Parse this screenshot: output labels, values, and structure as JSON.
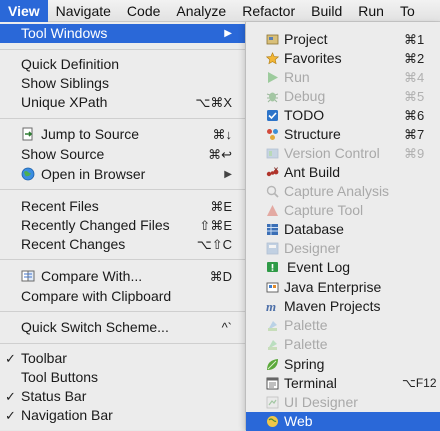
{
  "menubar": {
    "items": [
      {
        "label": "View",
        "active": true
      },
      {
        "label": "Navigate"
      },
      {
        "label": "Code"
      },
      {
        "label": "Analyze"
      },
      {
        "label": "Refactor"
      },
      {
        "label": "Build"
      },
      {
        "label": "Run"
      },
      {
        "label": "To"
      }
    ]
  },
  "view_menu": {
    "tool_windows": {
      "label": "Tool Windows",
      "arrow": "▶"
    },
    "quick_definition": {
      "label": "Quick Definition"
    },
    "show_siblings": {
      "label": "Show Siblings"
    },
    "unique_xpath": {
      "label": "Unique XPath",
      "shortcut": "⌥⌘X"
    },
    "jump_to_source": {
      "label": "Jump to Source",
      "shortcut": "⌘↓",
      "icon": "jump-to-source-icon"
    },
    "show_source": {
      "label": "Show Source",
      "shortcut": "⌘↩"
    },
    "open_in_browser": {
      "label": "Open in Browser",
      "arrow": "▶",
      "icon": "globe-icon"
    },
    "recent_files": {
      "label": "Recent Files",
      "shortcut": "⌘E"
    },
    "recently_changed_files": {
      "label": "Recently Changed Files",
      "shortcut": "⇧⌘E"
    },
    "recent_changes": {
      "label": "Recent Changes",
      "shortcut": "⌥⇧C"
    },
    "compare_with": {
      "label": "Compare With...",
      "shortcut": "⌘D",
      "icon": "compare-icon"
    },
    "compare_with_clipboard": {
      "label": "Compare with Clipboard"
    },
    "quick_switch_scheme": {
      "label": "Quick Switch Scheme...",
      "shortcut": "^`"
    },
    "toolbar": {
      "label": "Toolbar",
      "checked": "✓"
    },
    "tool_buttons": {
      "label": "Tool Buttons"
    },
    "status_bar": {
      "label": "Status Bar",
      "checked": "✓"
    },
    "navigation_bar": {
      "label": "Navigation Bar",
      "checked": "✓"
    }
  },
  "tool_windows_menu": {
    "project": {
      "label": "Project",
      "shortcut": "⌘1",
      "icon": "project-folder-icon"
    },
    "favorites": {
      "label": "Favorites",
      "shortcut": "⌘2",
      "icon": "star-icon"
    },
    "run": {
      "label": "Run",
      "shortcut": "⌘4",
      "icon": "run-icon",
      "disabled": true
    },
    "debug": {
      "label": "Debug",
      "shortcut": "⌘5",
      "icon": "bug-icon",
      "disabled": true
    },
    "todo": {
      "label": "TODO",
      "shortcut": "⌘6",
      "icon": "todo-icon"
    },
    "structure": {
      "label": "Structure",
      "shortcut": "⌘7",
      "icon": "structure-icon"
    },
    "version_control": {
      "label": "Version Control",
      "shortcut": "⌘9",
      "icon": "version-control-icon",
      "disabled": true
    },
    "ant_build": {
      "label": "Ant Build",
      "icon": "ant-icon"
    },
    "capture_analysis": {
      "label": "Capture Analysis",
      "icon": "capture-analysis-icon",
      "disabled": true
    },
    "capture_tool": {
      "label": "Capture Tool",
      "icon": "capture-tool-icon",
      "disabled": true
    },
    "database": {
      "label": "Database",
      "icon": "database-icon"
    },
    "designer": {
      "label": "Designer",
      "icon": "designer-icon",
      "disabled": true
    },
    "event_log": {
      "label": "Event Log",
      "icon": "event-log-icon"
    },
    "java_enterprise": {
      "label": "Java Enterprise",
      "icon": "java-enterprise-icon"
    },
    "maven_projects": {
      "label": "Maven Projects",
      "icon": "maven-icon"
    },
    "palette_1": {
      "label": "Palette",
      "icon": "palette-icon",
      "disabled": true
    },
    "palette_2": {
      "label": "Palette",
      "icon": "palette-icon",
      "disabled": true
    },
    "spring": {
      "label": "Spring",
      "icon": "spring-leaf-icon"
    },
    "terminal": {
      "label": "Terminal",
      "shortcut": "⌥F12",
      "icon": "terminal-icon"
    },
    "ui_designer": {
      "label": "UI Designer",
      "icon": "ui-designer-icon",
      "disabled": true
    },
    "web": {
      "label": "Web",
      "icon": "web-globe-icon",
      "highlighted": true
    }
  },
  "colors": {
    "highlight": "#2a68d8",
    "menu_background": "#ececec",
    "disabled_text": "#a9a9a9"
  }
}
